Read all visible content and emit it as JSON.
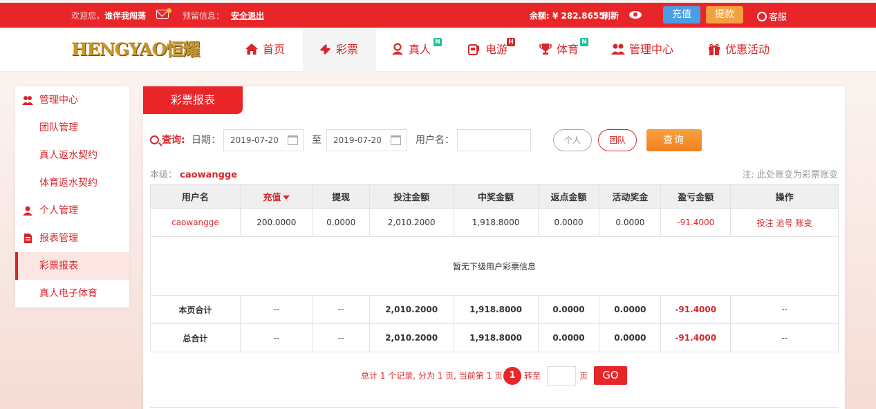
{
  "topbar": {
    "welcome_prefix": "欢迎您，",
    "username": "谁伴我闯荡",
    "reserve_label": "预留信息：",
    "logout": "安全退出",
    "balance": "余额: ¥ 282.8655",
    "refresh": "刷新",
    "recharge": "充值",
    "withdraw": "提款",
    "service": "客服"
  },
  "logo": {
    "text": "HENGYAO恒耀"
  },
  "nav": {
    "items": [
      {
        "label": "首页"
      },
      {
        "label": "彩票"
      },
      {
        "label": "真人",
        "badge": "N"
      },
      {
        "label": "电游",
        "badge": "H"
      },
      {
        "label": "体育",
        "badge": "N"
      },
      {
        "label": "管理中心"
      },
      {
        "label": "优惠活动"
      }
    ]
  },
  "sidebar": {
    "items": [
      {
        "label": "管理中心"
      },
      {
        "label": "团队管理"
      },
      {
        "label": "真人返水契约"
      },
      {
        "label": "体育返水契约"
      },
      {
        "label": "个人管理"
      },
      {
        "label": "报表管理"
      },
      {
        "label": "彩票报表"
      },
      {
        "label": "真人电子体育"
      }
    ]
  },
  "main": {
    "title": "彩票报表",
    "query_label": "查询:",
    "date_label": "日期：",
    "date_from": "2019-07-20",
    "to_label": "至",
    "date_to": "2019-07-20",
    "user_label": "用户名：",
    "user_value": "",
    "btn_personal": "个人",
    "btn_team": "团队",
    "btn_query": "查询",
    "level_label": "本级：",
    "level_user": "caowangge",
    "note": "注: 此处账变为彩票账变"
  },
  "table": {
    "headers": [
      "用户名",
      "充值",
      "提现",
      "投注金额",
      "中奖金额",
      "返点金额",
      "活动奖金",
      "盈亏金额",
      "操作"
    ],
    "row": [
      "caowangge",
      "200.0000",
      "0.0000",
      "2,010.2000",
      "1,918.8000",
      "0.0000",
      "0.0000",
      "-91.4000"
    ],
    "ops": [
      "投注",
      "追号",
      "账变"
    ],
    "empty_message": "暂无下级用户彩票信息",
    "page_sum": [
      "本页合计",
      "--",
      "--",
      "2,010.2000",
      "1,918.8000",
      "0.0000",
      "0.0000",
      "-91.4000",
      "--"
    ],
    "total_sum": [
      "总合计",
      "--",
      "--",
      "2,010.2000",
      "1,918.8000",
      "0.0000",
      "0.0000",
      "-91.4000",
      "--"
    ]
  },
  "pager": {
    "summary": "总计 1 个记录, 分为 1 页, 当前第 1 页",
    "current": "1",
    "goto": "转至",
    "page_unit": "页",
    "go": "GO"
  },
  "colors": {
    "brand_red": "#e8262a",
    "orange": "#f08020",
    "blue": "#4a9ee8"
  }
}
